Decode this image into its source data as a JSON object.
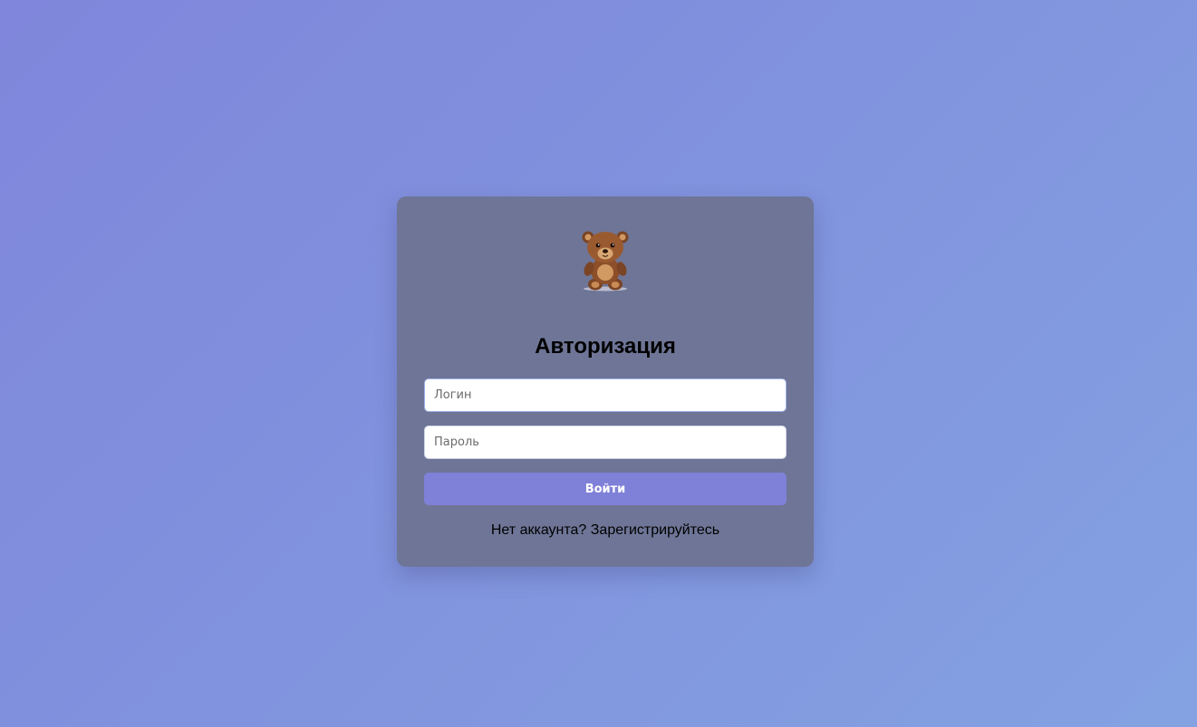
{
  "page": {
    "background_colors": [
      "#7f86db",
      "#84a2e2"
    ]
  },
  "card": {
    "background_color": "#6e7596",
    "logo_icon": "teddy-bear-icon",
    "title": "Авторизация",
    "login_field": {
      "placeholder": "Логин",
      "value": ""
    },
    "password_field": {
      "placeholder": "Пароль",
      "value": ""
    },
    "submit_label": "Войти",
    "submit_color": "#7f80d8",
    "register_text": "Нет аккаунта? ",
    "register_link": "Зарегистрируйтесь"
  }
}
